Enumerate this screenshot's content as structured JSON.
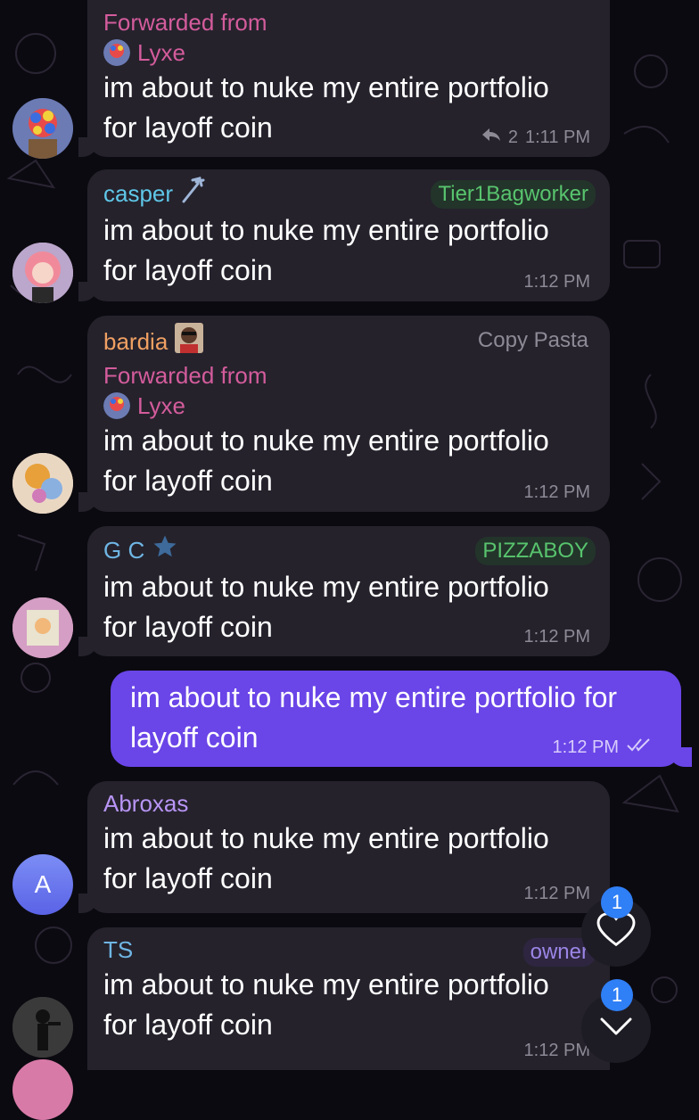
{
  "colors": {
    "background": "#0b0a10",
    "incoming_bubble": "#25222c",
    "outgoing_bubble": "#6a45e8",
    "forward_label": "#d45c9c",
    "time_text": "#8d8a96",
    "badge": "#2f7ff6"
  },
  "messages": [
    {
      "forwarded_label": "Forwarded from",
      "forwarded_name": "Lyxe",
      "text": "im about to nuke my entire portfolio for layoff coin",
      "replies": "2",
      "time": "1:11 PM",
      "reply_icon": "reply-arrow-icon"
    },
    {
      "sender": "casper",
      "sender_color": "#5fc7e8",
      "sender_icon": "trident-icon",
      "tag": "Tier1Bagworker",
      "tag_color": "#58c46e",
      "text": "im about to nuke my entire portfolio for layoff coin",
      "time": "1:12 PM"
    },
    {
      "sender": "bardia",
      "sender_color": "#f0a062",
      "tag": "Copy Pasta",
      "tag_color": "#8d8a96",
      "forwarded_label": "Forwarded from",
      "forwarded_name": "Lyxe",
      "text": "im about to nuke my entire portfolio for layoff coin",
      "time": "1:12 PM"
    },
    {
      "sender": "G C",
      "sender_color": "#6fb6e4",
      "sender_icon": "star-icon",
      "tag": "PIZZABOY",
      "tag_color": "#58c46e",
      "text": "im about to nuke my entire portfolio for layoff coin",
      "time": "1:12 PM"
    },
    {
      "outgoing": true,
      "text": "im about to nuke my entire portfolio for layoff coin",
      "time": "1:12 PM",
      "status_icon": "double-check-icon"
    },
    {
      "sender": "Abroxas",
      "sender_color": "#b895f5",
      "avatar_letter": "A",
      "text": "im about to nuke my entire portfolio for layoff coin",
      "time": "1:12 PM"
    },
    {
      "sender": "TS",
      "sender_color": "#6fb6e4",
      "tag": "owner",
      "tag_color": "#9b85e6",
      "text": "im about to nuke my entire portfolio for layoff coin",
      "time": "1:12 PM"
    }
  ],
  "floating": {
    "reactions_badge": "1",
    "reactions_icon": "heart-icon",
    "scroll_badge": "1",
    "scroll_icon": "chevron-down-icon"
  }
}
